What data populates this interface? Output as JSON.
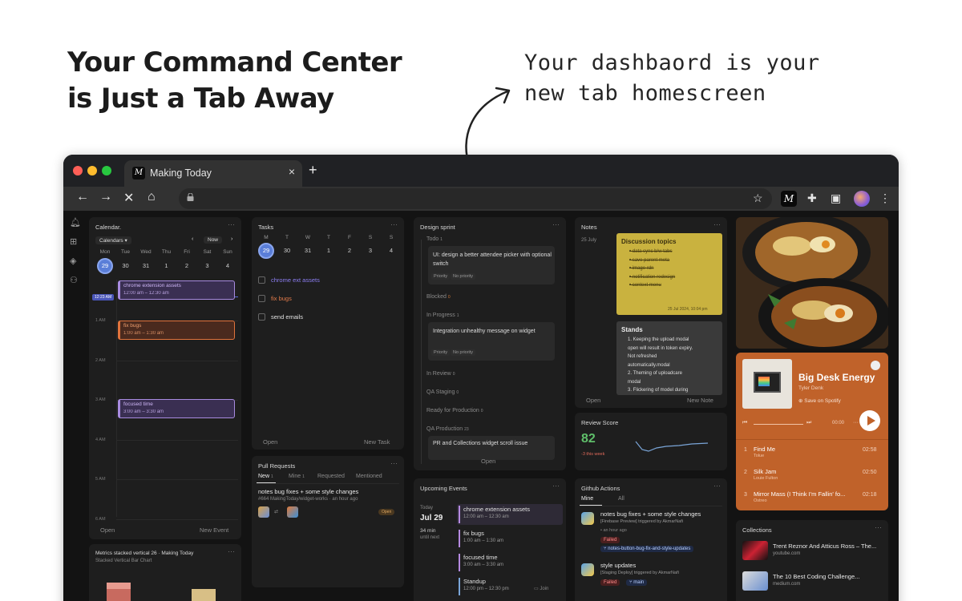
{
  "headline": {
    "line1": "Your Command Center",
    "line2": "is Just a Tab Away"
  },
  "handwritten": {
    "line1": "Your dashbaord is your",
    "line2": "new tab homescreen"
  },
  "browser": {
    "tab_title": "Making Today",
    "tab_favicon": "M",
    "tab_close": "×",
    "new_tab": "+",
    "ext_label": "M"
  },
  "calendar": {
    "title": "Calendar.",
    "dropdown": "Calendars",
    "now_label": "Now",
    "days": [
      "Mon",
      "Tue",
      "Wed",
      "Thu",
      "Fri",
      "Sat",
      "Sun"
    ],
    "dates": [
      "29",
      "30",
      "31",
      "1",
      "2",
      "3",
      "4"
    ],
    "time_marker": "12:23 AM",
    "hours": [
      "1 AM",
      "2 AM",
      "3 AM",
      "4 AM",
      "5 AM",
      "6 AM"
    ],
    "events": [
      {
        "title": "chrome extension assets",
        "time": "12:00 am – 12:30 am"
      },
      {
        "title": "fix bugs",
        "time": "1:00 am – 1:30 am"
      },
      {
        "title": "focused time",
        "time": "3:00 am – 3:30 am"
      }
    ],
    "open": "Open",
    "new_event": "New Event"
  },
  "metrics": {
    "title": "Metrics stacked vertical 26  ·  Making Today",
    "subtitle": "Stacked Vertical Bar Chart"
  },
  "tasks": {
    "title": "Tasks",
    "days": [
      "M",
      "T",
      "W",
      "T",
      "F",
      "S",
      "S"
    ],
    "dates": [
      "29",
      "30",
      "31",
      "1",
      "2",
      "3",
      "4"
    ],
    "items": [
      "chrome ext assets",
      "fix bugs",
      "send emails"
    ],
    "open": "Open",
    "new_task": "New Task"
  },
  "pull_requests": {
    "title": "Pull Requests",
    "tabs": [
      "New",
      "Mine",
      "Requested",
      "Mentioned"
    ],
    "new_count": "1",
    "mine_count": "1",
    "pr_title": "notes bug fixes + some style changes",
    "pr_meta": "#664 MakingToday/widget-works · an hour ago",
    "pr_badge": "Open"
  },
  "design_sprint": {
    "title": "Design sprint",
    "todo": "Todo",
    "todo_count": "1",
    "todo_card": "UI: design a better attendee picker with optional switch",
    "priority": "Priority",
    "no_priority": "No priority",
    "blocked": "Blocked",
    "blocked_count": "0",
    "in_progress": "In Progress",
    "in_progress_count": "1",
    "progress_card": "Integration unhealthy message on widget",
    "in_review": "In Review",
    "in_review_count": "0",
    "qa_staging": "QA Staging",
    "qa_staging_count": "0",
    "ready": "Ready for Production",
    "ready_count": "0",
    "qa_production": "QA Production",
    "qa_production_count": "23",
    "prod_card": "PR and Collections widget scroll issue",
    "open": "Open"
  },
  "upcoming": {
    "title": "Upcoming Events",
    "today": "Today",
    "date": "Jul 29",
    "countdown": "34 min",
    "until": "until next",
    "events": [
      {
        "title": "chrome extension assets",
        "time": "12:00 am – 12:30 am"
      },
      {
        "title": "fix bugs",
        "time": "1:00 am – 1:30 am"
      },
      {
        "title": "focused time",
        "time": "3:00 am – 3:30 am"
      },
      {
        "title": "Standup",
        "time": "12:00 pm – 12:30 pm"
      }
    ],
    "join": "Join"
  },
  "notes": {
    "title": "Notes",
    "date": "25 July",
    "yellow_title": "Discussion topics",
    "yellow_items": [
      "data sync b/w tabs",
      "save parent meta",
      "image rdn",
      "notification redesign",
      "context menu"
    ],
    "yellow_date": "25 Jul 2024, 10:04 pm",
    "gray_title": "Stands",
    "gray_lines": [
      "1. Keeping the upload modal",
      "open will result in token expiry.",
      "Not refreshed",
      "automatically.modal",
      "2. Theming of uploadcare",
      "modal",
      "3. Flickering of model during"
    ],
    "open": "Open",
    "new_note": "New Note"
  },
  "review": {
    "title": "Review Score",
    "score": "82",
    "change": "-3 this week"
  },
  "github": {
    "title": "Github Actions",
    "tabs": [
      "Mine",
      "All"
    ],
    "runs": [
      {
        "title": "notes bug fixes + some style changes",
        "meta": "[Firebase Preview] triggered by AkmarNafi",
        "time": "an hour ago",
        "status": "Failed",
        "branch": "notes-button-bug-fix-and-style-updates"
      },
      {
        "title": "style updates",
        "meta": "[Staging Deploy] triggered by AkmarNafi",
        "status": "Failed",
        "branch": "main"
      }
    ]
  },
  "spotify": {
    "track": "Big Desk Energy",
    "artist": "Tyler Denk",
    "save": "Save on Spotify",
    "time_current": "00:00",
    "list": [
      {
        "n": "1",
        "title": "Find Me",
        "artist": "Tolue",
        "dur": "02:58"
      },
      {
        "n": "2",
        "title": "Silk Jam",
        "artist": "Louie Fulton",
        "dur": "02:50"
      },
      {
        "n": "3",
        "title": "Mirror Mass (I Think I'm Fallin' fo...",
        "artist": "Ostreo",
        "dur": "02:18"
      }
    ],
    "accent": "#c0622a"
  },
  "collections": {
    "title": "Collections",
    "items": [
      {
        "title": "Trent Reznor And Atticus Ross – The...",
        "source": "youtube.com"
      },
      {
        "title": "The 10 Best Coding Challenge...",
        "source": "medium.com"
      }
    ]
  }
}
